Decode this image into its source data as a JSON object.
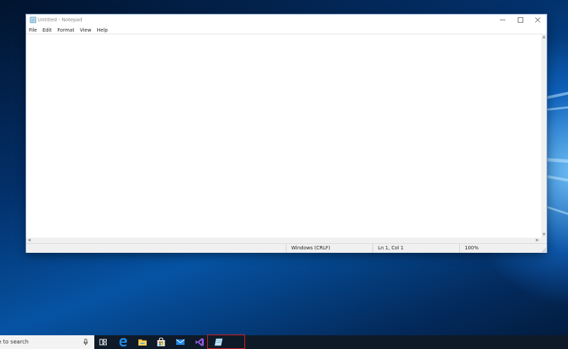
{
  "window": {
    "title": "Untitled - Notepad",
    "controls": [
      "minimize",
      "maximize",
      "close"
    ]
  },
  "menu": {
    "items": [
      "File",
      "Edit",
      "Format",
      "View",
      "Help"
    ]
  },
  "editor": {
    "text": ""
  },
  "statusbar": {
    "line_ending": "Windows (CRLF)",
    "position": "Ln 1, Col 1",
    "zoom": "100%"
  },
  "taskbar": {
    "search_text": "e to search",
    "icons": [
      "task-view-icon",
      "edge-icon",
      "file-explorer-icon",
      "store-icon",
      "mail-icon",
      "visual-studio-icon",
      "notepad-icon"
    ]
  }
}
